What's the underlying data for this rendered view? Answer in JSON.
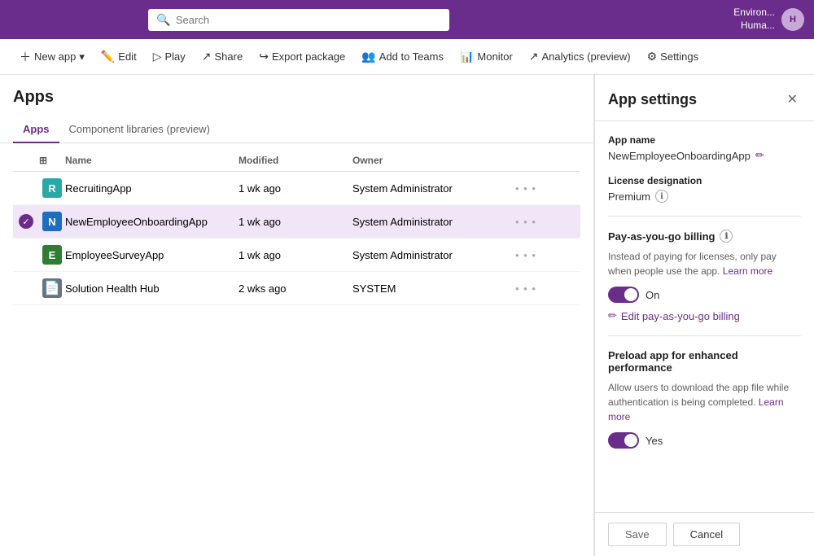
{
  "topbar": {
    "search_placeholder": "Search",
    "env_line1": "Environ...",
    "env_line2": "Huma...",
    "avatar_text": "H"
  },
  "toolbar": {
    "new_app": "New app",
    "edit": "Edit",
    "play": "Play",
    "share": "Share",
    "export_package": "Export package",
    "add_to_teams": "Add to Teams",
    "monitor": "Monitor",
    "analytics": "Analytics (preview)",
    "settings": "Settings"
  },
  "page": {
    "title": "Apps",
    "tabs": [
      "Apps",
      "Component libraries (preview)"
    ],
    "active_tab": 0
  },
  "table": {
    "headers": [
      "",
      "",
      "Name",
      "Modified",
      "Owner",
      ""
    ],
    "rows": [
      {
        "id": 1,
        "name": "RecruitingApp",
        "icon_type": "teal",
        "icon_letter": "R",
        "modified": "1 wk ago",
        "owner": "System Administrator",
        "selected": false
      },
      {
        "id": 2,
        "name": "NewEmployeeOnboardingApp",
        "icon_type": "blue",
        "icon_letter": "N",
        "modified": "1 wk ago",
        "owner": "System Administrator",
        "selected": true
      },
      {
        "id": 3,
        "name": "EmployeeSurveyApp",
        "icon_type": "green",
        "icon_letter": "E",
        "modified": "1 wk ago",
        "owner": "System Administrator",
        "selected": false
      },
      {
        "id": 4,
        "name": "Solution Health Hub",
        "icon_type": "doc",
        "icon_letter": "📄",
        "modified": "2 wks ago",
        "owner": "SYSTEM",
        "selected": false
      }
    ]
  },
  "app_settings": {
    "title": "App settings",
    "app_name_label": "App name",
    "app_name_value": "NewEmployeeOnboardingApp",
    "license_label": "License designation",
    "license_value": "Premium",
    "pay_as_you_go_label": "Pay-as-you-go billing",
    "pay_as_you_go_desc": "Instead of paying for licenses, only pay when people use the app.",
    "learn_more_payt": "Learn more",
    "pay_toggle_label": "On",
    "edit_billing_label": "Edit pay-as-you-go billing",
    "preload_label": "Preload app for enhanced performance",
    "preload_desc": "Allow users to download the app file while authentication is being completed.",
    "learn_more_preload": "Learn more",
    "preload_toggle_label": "Yes",
    "save_label": "Save",
    "cancel_label": "Cancel"
  }
}
